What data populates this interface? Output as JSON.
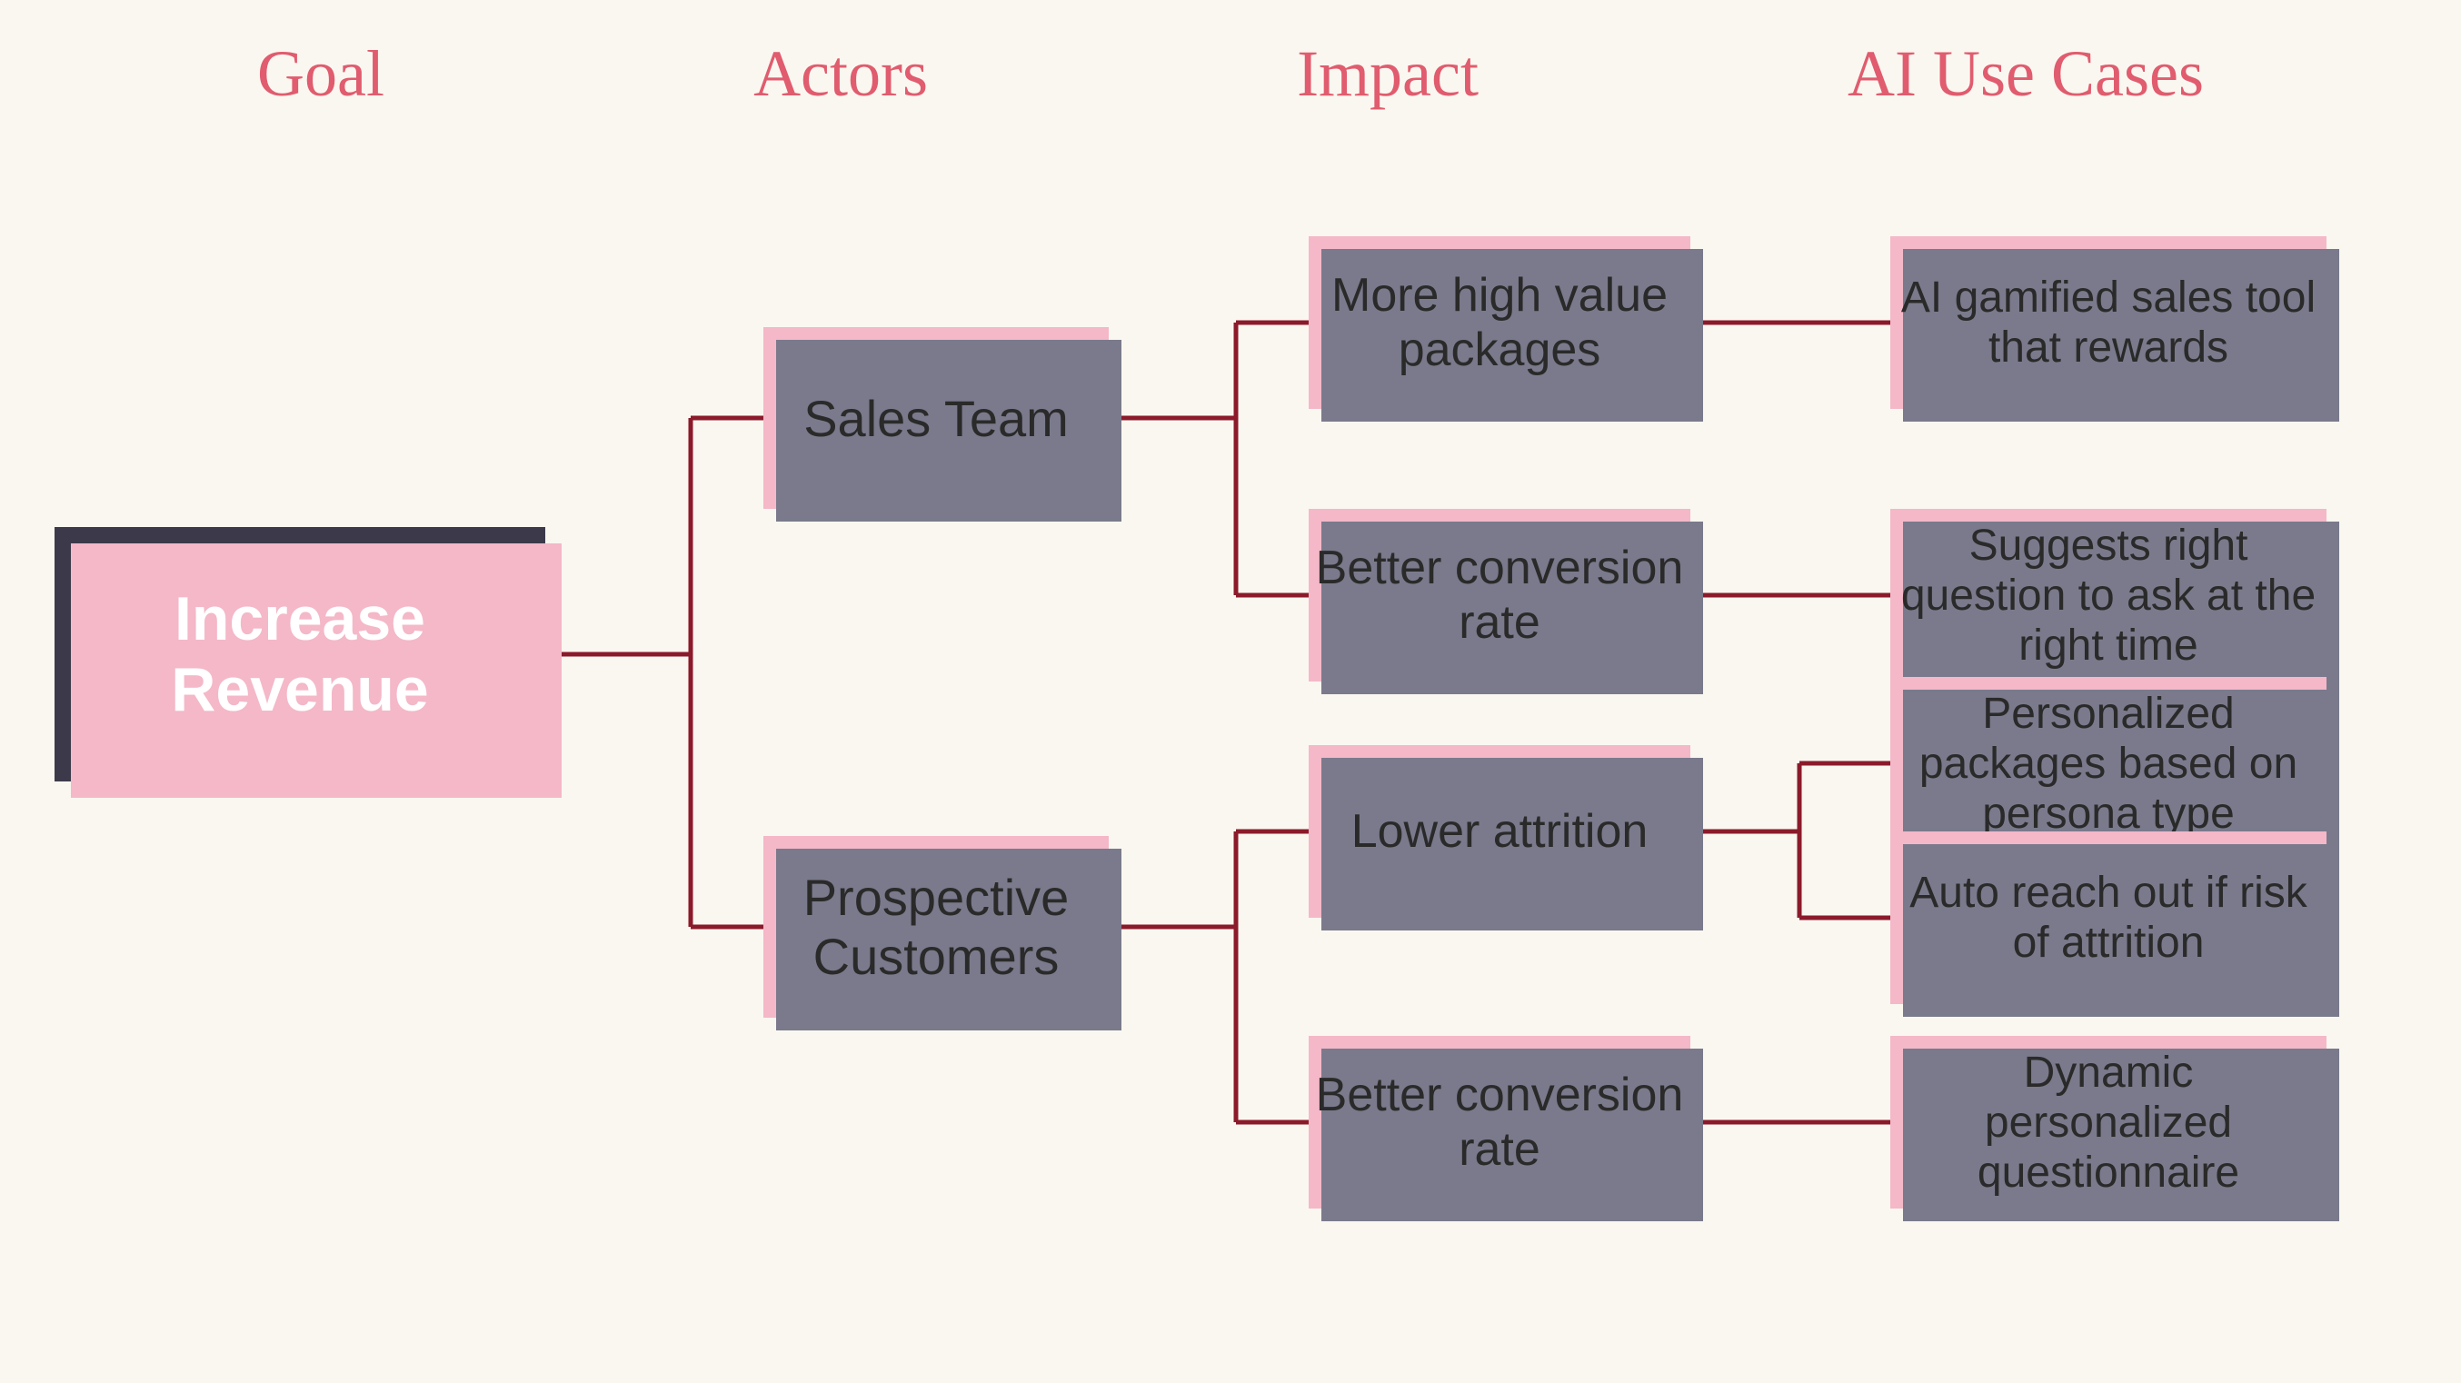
{
  "header": {
    "col1": "Goal",
    "col2": "Actors",
    "col3": "Impact",
    "col4": "AI Use Cases"
  },
  "goal": {
    "label": "Increase Revenue"
  },
  "actors": [
    {
      "id": "sales-team",
      "label": "Sales Team"
    },
    {
      "id": "prospective-customers",
      "label": "Prospective Customers"
    }
  ],
  "impacts": [
    {
      "id": "more-high-value",
      "label": "More high value packages",
      "actor": "sales-team"
    },
    {
      "id": "better-conversion-1",
      "label": "Better conversion rate",
      "actor": "sales-team"
    },
    {
      "id": "lower-attrition",
      "label": "Lower attrition",
      "actor": "prospective-customers"
    },
    {
      "id": "better-conversion-2",
      "label": "Better conversion rate",
      "actor": "prospective-customers"
    }
  ],
  "usecases": [
    {
      "id": "ai-gamified",
      "label": "AI gamified sales tool that rewards",
      "impact": "more-high-value"
    },
    {
      "id": "suggests-question",
      "label": "Suggests right question to ask at the right time",
      "impact": "better-conversion-1"
    },
    {
      "id": "personalized-packages",
      "label": "Personalized packages based on persona type",
      "impact": "lower-attrition"
    },
    {
      "id": "auto-reach-out",
      "label": "Auto reach out if risk of attrition",
      "impact": "lower-attrition"
    },
    {
      "id": "dynamic-questionnaire",
      "label": "Dynamic personalized questionnaire",
      "impact": "better-conversion-2"
    }
  ],
  "colors": {
    "background": "#faf7f0",
    "header": "#e05c6e",
    "goal_bg": "#3c3a4a",
    "goal_text": "#ffffff",
    "actor_bg": "#f4b8c8",
    "impact_bg": "#f4b8c8",
    "usecase_bg": "#f4b8c8",
    "shadow": "#7a7a8c",
    "connector": "#8b1a2a"
  }
}
